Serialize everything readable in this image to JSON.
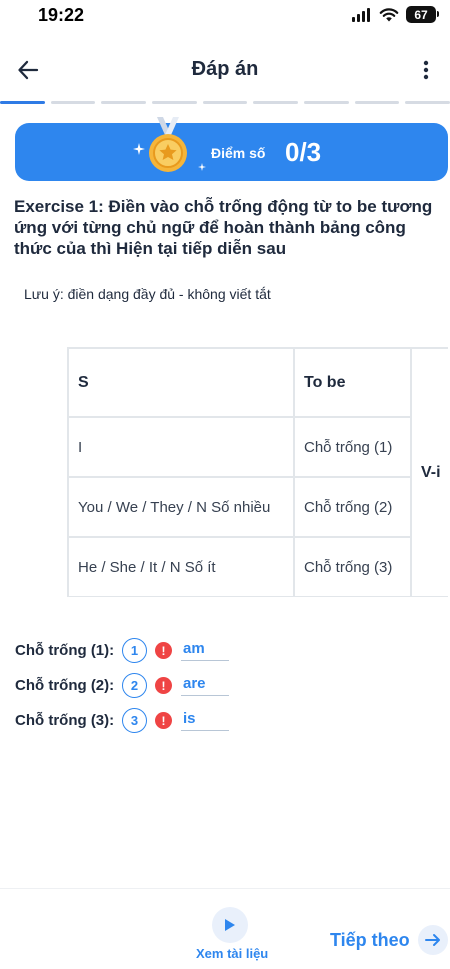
{
  "status_bar": {
    "time": "19:22",
    "battery": "67"
  },
  "header": {
    "title": "Đáp án"
  },
  "progress": {
    "segments": 9,
    "active_index": 0
  },
  "score": {
    "label": "Điểm số",
    "value": "0/3"
  },
  "exercise": {
    "title": "Exercise 1: Điền vào chỗ trống động từ to be tương ứng với từng chủ ngữ để hoàn thành bảng công thức của thì Hiện tại tiếp diễn sau",
    "note": "Lưu ý: điền dạng đầy đủ - không viết tắt"
  },
  "table": {
    "headers": [
      "S",
      "To be"
    ],
    "rows": [
      {
        "subject": "I",
        "to_be": "Chỗ trống (1)"
      },
      {
        "subject": "You / We / They / N Số nhiều",
        "to_be": "Chỗ trống (2)"
      },
      {
        "subject": "He / She / It / N Số ít",
        "to_be": "Chỗ trống (3)"
      }
    ],
    "verb_partial": "V-i"
  },
  "answers": [
    {
      "label": "Chỗ trống (1):",
      "number": "1",
      "value": "am"
    },
    {
      "label": "Chỗ trống (2):",
      "number": "2",
      "value": "are"
    },
    {
      "label": "Chỗ trống (3):",
      "number": "3",
      "value": "is"
    }
  ],
  "bottom": {
    "docs_label": "Xem tài liệu",
    "next_label": "Tiếp theo"
  },
  "colors": {
    "primary": "#2e86ee",
    "error": "#ef4444",
    "title_text": "#1f2a3d",
    "medal_gold": "#f5b53a"
  },
  "icons": [
    "back-arrow-icon",
    "more-vertical-icon",
    "medal-icon",
    "error-icon",
    "play-icon",
    "arrow-right-icon",
    "signal-icon",
    "wifi-icon",
    "battery-icon"
  ]
}
